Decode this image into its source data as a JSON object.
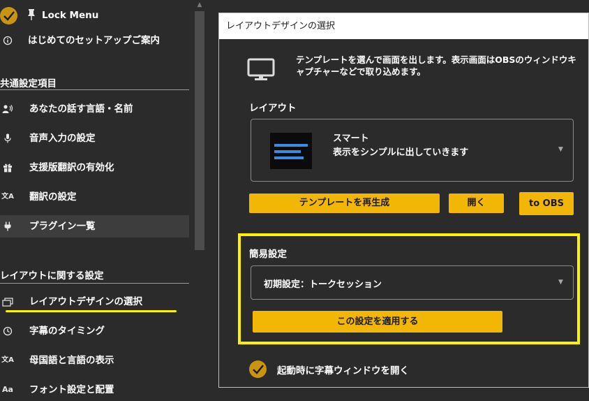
{
  "sidebar": {
    "lock_menu": "Lock Menu",
    "setup_guide": "はじめてのセットアップご案内",
    "section_common": "共通設定項目",
    "items_common": [
      {
        "label": "あなたの話す言語・名前",
        "icon": "person-voice-icon"
      },
      {
        "label": "音声入力の設定",
        "icon": "microphone-icon"
      },
      {
        "label": "支援版翻訳の有効化",
        "icon": "gift-icon"
      },
      {
        "label": "翻訳の設定",
        "icon": "translate-icon"
      },
      {
        "label": "プラグイン一覧",
        "icon": "plug-icon"
      }
    ],
    "section_layout": "レイアウトに関する設定",
    "items_layout": [
      {
        "label": "レイアウトデザインの選択",
        "icon": "layout-icon"
      },
      {
        "label": "字幕のタイミング",
        "icon": "timer-icon"
      },
      {
        "label": "母国語と言語の表示",
        "icon": "language-icon"
      },
      {
        "label": "フォント設定と配置",
        "icon": "font-icon"
      }
    ]
  },
  "panel": {
    "title": "レイアウトデザインの選択",
    "description": "テンプレートを選んで画面を出します。表示画面はOBSのウィンドウキャプチャーなどで取り込めます。",
    "layout_label": "レイアウト",
    "layout_combo": {
      "name": "スマート",
      "subtitle": "表示をシンプルに出していきます"
    },
    "buttons": {
      "regenerate": "テンプレートを再生成",
      "open": "開く",
      "to_obs": "to OBS"
    },
    "quick_settings": {
      "label": "簡易設定",
      "selected": "初期設定：トークセッション",
      "apply": "この設定を適用する"
    },
    "startup_checkbox": "起動時に字幕ウィンドウを開く"
  },
  "colors": {
    "accent": "#f2b705",
    "check": "#c89512",
    "highlight": "#fff200",
    "background": "#2b2b2b"
  }
}
